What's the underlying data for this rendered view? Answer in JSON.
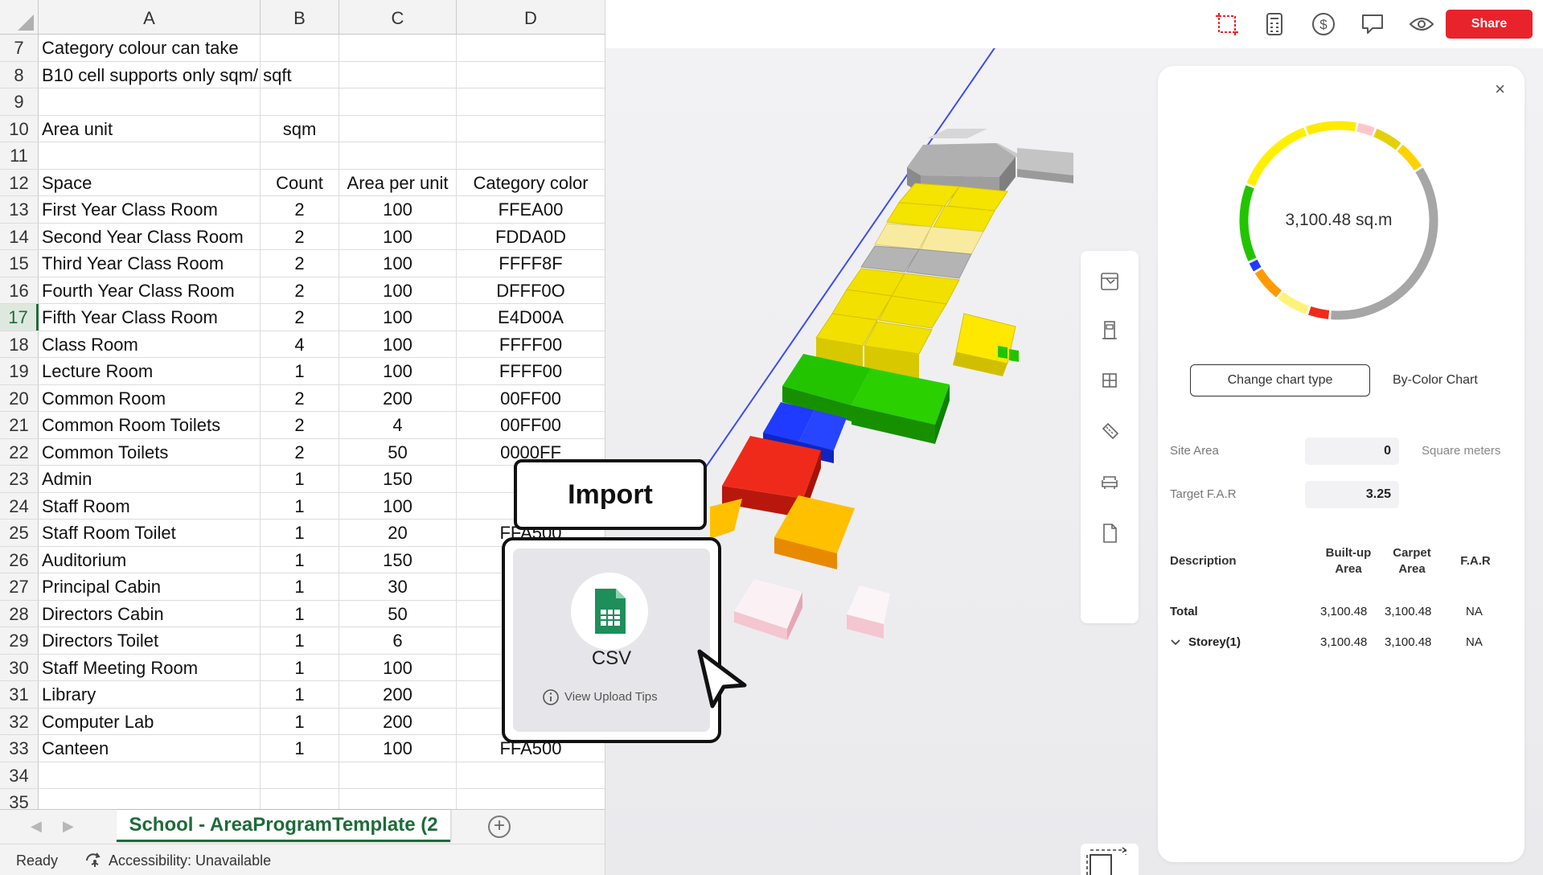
{
  "sheet": {
    "columns": [
      "A",
      "B",
      "C",
      "D"
    ],
    "rows": [
      {
        "n": "7",
        "a": "Category colour can take",
        "b": "",
        "c": "",
        "d": ""
      },
      {
        "n": "8",
        "a": "B10 cell supports only sqm/ sqft",
        "b": "",
        "c": "",
        "d": ""
      },
      {
        "n": "9",
        "a": "",
        "b": "",
        "c": "",
        "d": ""
      },
      {
        "n": "10",
        "a": "Area unit",
        "b": "sqm",
        "c": "",
        "d": ""
      },
      {
        "n": "11",
        "a": "",
        "b": "",
        "c": "",
        "d": ""
      },
      {
        "n": "12",
        "a": "Space",
        "b": "Count",
        "c": "Area per unit",
        "d": "Category color"
      },
      {
        "n": "13",
        "a": "First Year Class Room",
        "b": "2",
        "c": "100",
        "d": "FFEA00"
      },
      {
        "n": "14",
        "a": "Second Year Class Room",
        "b": "2",
        "c": "100",
        "d": "FDDA0D"
      },
      {
        "n": "15",
        "a": "Third Year Class Room",
        "b": "2",
        "c": "100",
        "d": "FFFF8F"
      },
      {
        "n": "16",
        "a": "Fourth Year Class Room",
        "b": "2",
        "c": "100",
        "d": "DFFF0O"
      },
      {
        "n": "17",
        "a": "Fifth Year Class Room",
        "b": "2",
        "c": "100",
        "d": "E4D00A"
      },
      {
        "n": "18",
        "a": "Class Room",
        "b": "4",
        "c": "100",
        "d": "FFFF00"
      },
      {
        "n": "19",
        "a": "Lecture Room",
        "b": "1",
        "c": "100",
        "d": "FFFF00"
      },
      {
        "n": "20",
        "a": "Common Room",
        "b": "2",
        "c": "200",
        "d": "00FF00"
      },
      {
        "n": "21",
        "a": "Common Room Toilets",
        "b": "2",
        "c": "4",
        "d": "00FF00"
      },
      {
        "n": "22",
        "a": "Common Toilets",
        "b": "2",
        "c": "50",
        "d": "0000FF"
      },
      {
        "n": "23",
        "a": "Admin",
        "b": "1",
        "c": "150",
        "d": "F"
      },
      {
        "n": "24",
        "a": "Staff Room",
        "b": "1",
        "c": "100",
        "d": "F"
      },
      {
        "n": "25",
        "a": "Staff Room Toilet",
        "b": "1",
        "c": "20",
        "d": "FFA500"
      },
      {
        "n": "26",
        "a": "Auditorium",
        "b": "1",
        "c": "150",
        "d": ""
      },
      {
        "n": "27",
        "a": "Principal Cabin",
        "b": "1",
        "c": "30",
        "d": ""
      },
      {
        "n": "28",
        "a": "Directors Cabin",
        "b": "1",
        "c": "50",
        "d": ""
      },
      {
        "n": "29",
        "a": "Directors Toilet",
        "b": "1",
        "c": "6",
        "d": ""
      },
      {
        "n": "30",
        "a": "Staff Meeting Room",
        "b": "1",
        "c": "100",
        "d": ""
      },
      {
        "n": "31",
        "a": "Library",
        "b": "1",
        "c": "200",
        "d": ""
      },
      {
        "n": "32",
        "a": "Computer Lab",
        "b": "1",
        "c": "200",
        "d": ""
      },
      {
        "n": "33",
        "a": "Canteen",
        "b": "1",
        "c": "100",
        "d": "FFA500"
      },
      {
        "n": "34",
        "a": "",
        "b": "",
        "c": "",
        "d": ""
      },
      {
        "n": "35",
        "a": "",
        "b": "",
        "c": "",
        "d": ""
      }
    ],
    "selected_row": "17",
    "tab_name": "School - AreaProgramTemplate (2",
    "add_sheet_symbol": "+",
    "status_ready": "Ready",
    "status_accessibility": "Accessibility: Unavailable"
  },
  "app": {
    "share_label": "Share",
    "accent": "#e8232b",
    "topbar_icons": [
      "crop-icon",
      "calculator-icon",
      "dollar-icon",
      "comment-icon",
      "eye-icon"
    ],
    "side_tools": [
      "box-icon",
      "door-icon",
      "window-grid-icon",
      "measure-icon",
      "sofa-icon",
      "document-icon"
    ],
    "panel": {
      "close_symbol": "×",
      "total_area_label": "3,100.48 sq.m",
      "donut_segments": [
        {
          "color": "#FFEA00",
          "value": 7
        },
        {
          "color": "#FFC5CC",
          "value": 2.5
        },
        {
          "color": "#E4D00A",
          "value": 4
        },
        {
          "color": "#FFD200",
          "value": 4
        },
        {
          "color": "#A6A6A6",
          "value": 29
        },
        {
          "color": "#F02A1A",
          "value": 3
        },
        {
          "color": "#FFF27A",
          "value": 4.5
        },
        {
          "color": "#FF9B00",
          "value": 4.5
        },
        {
          "color": "#1F3BFF",
          "value": 1.5
        },
        {
          "color": "#22C400",
          "value": 10.5
        },
        {
          "color": "#FFF000",
          "value": 11
        }
      ],
      "change_chart_label": "Change chart type",
      "by_color_label": "By-Color Chart",
      "site_area_label": "Site Area",
      "site_area_value": "0",
      "site_area_unit": "Square meters",
      "target_far_label": "Target F.A.R",
      "target_far_value": "3.25",
      "table_headers": {
        "description": "Description",
        "built_up": "Built-up Area",
        "carpet": "Carpet Area",
        "far": "F.A.R"
      },
      "rows": [
        {
          "desc": "Total",
          "built_up": "3,100.48",
          "carpet": "3,100.48",
          "far": "NA"
        },
        {
          "desc": "Storey(1)",
          "built_up": "3,100.48",
          "carpet": "3,100.48",
          "far": "NA"
        }
      ]
    }
  },
  "overlay": {
    "import_label": "Import",
    "csv_label": "CSV",
    "tips_label": "View Upload Tips"
  }
}
